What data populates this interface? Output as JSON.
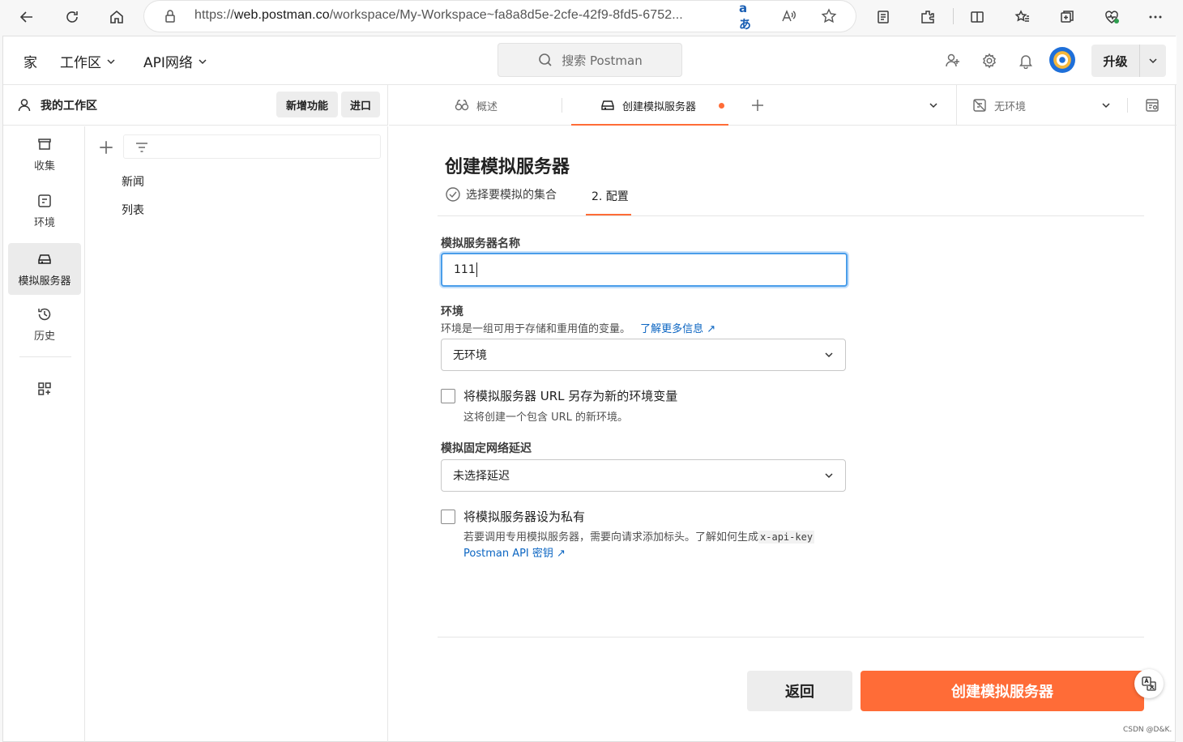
{
  "browser": {
    "url_prefix": "https://",
    "url_host": "web.postman.co",
    "url_path": "/workspace/My-Workspace~fa8a8d5e-2cfe-42f9-8fd5-6752..."
  },
  "header": {
    "home_label": "家",
    "workspaces_label": "工作区",
    "api_network_label": "API网络",
    "search_placeholder": "搜索 Postman",
    "upgrade_label": "升级"
  },
  "workspace": {
    "title": "我的工作区",
    "new_button": "新增功能",
    "import_button": "进口"
  },
  "rail": {
    "items": [
      {
        "label": "收集",
        "icon": "collections-icon"
      },
      {
        "label": "环境",
        "icon": "environments-icon"
      },
      {
        "label": "模拟服务器",
        "icon": "mock-server-icon"
      },
      {
        "label": "历史",
        "icon": "history-icon"
      }
    ]
  },
  "tree": {
    "items": [
      "新闻",
      "列表"
    ]
  },
  "tabs": {
    "overview": "概述",
    "create_mock": "创建模拟服务器",
    "environment": "无环境"
  },
  "form": {
    "title": "创建模拟服务器",
    "step1": "选择要模拟的集合",
    "step2": "2. 配置",
    "name_label": "模拟服务器名称",
    "name_value": "111",
    "env_label": "环境",
    "env_desc": "环境是一组可用于存储和重用值的变量。",
    "env_link": "了解更多信息 ↗",
    "env_value": "无环境",
    "save_url_label": "将模拟服务器 URL 另存为新的环境变量",
    "save_url_desc": "这将创建一个包含 URL 的新环境。",
    "delay_label": "模拟固定网络延迟",
    "delay_value": "未选择延迟",
    "private_label": "将模拟服务器设为私有",
    "private_desc": "若要调用专用模拟服务器，需要向请求添加标头。了解如何生成",
    "private_code": "x-api-key",
    "private_link": "Postman API 密钥 ↗",
    "back_button": "返回",
    "create_button": "创建模拟服务器"
  },
  "watermark": "CSDN @D&K.",
  "colors": {
    "accent": "#ff6c37",
    "link": "#0b65c2",
    "focus": "#4a9eea"
  }
}
